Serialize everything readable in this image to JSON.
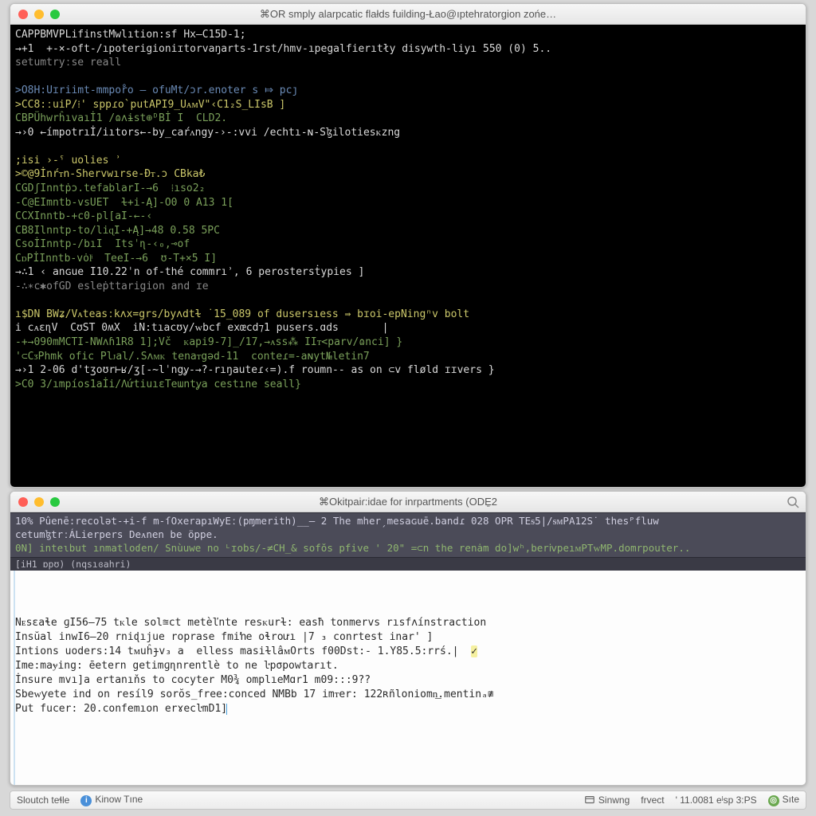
{
  "top_window": {
    "title": "⌘OR smply alarpcatic flałds fuilding-Łao@ıptehratorgion zońe…",
    "lines": [
      {
        "cls": "hl-w",
        "t": "CAPPBMVPLifinstMwlıtion:sf Hx–C15D-1;"
      },
      {
        "cls": "hl-w",
        "t": "→+1  +-×-oft-/ıpoterigioniɪtorvaŋarts-1rst/hmv-ıpegalfierıtły disywth-liyı 550 (0) 5.."
      },
      {
        "cls": "hl-d",
        "t": "setumtryːse reall"
      },
      {
        "cls": "",
        "t": ""
      },
      {
        "cls": "hl-b",
        "t": ">O8H:Uɪriimt-mmpor̊o — ofuMt/ɔr.enoter s ⤇ pcȷ"
      },
      {
        "cls": "hl-y",
        "t": ">CC8:ːuiP/⁞' sppɾo`putAPI9_UᴀᴍV\"‹C1₂S_LIsB ]"
      },
      {
        "cls": "hl-g",
        "t": "CBPÜhwrĥıvaıİ1 /ɷʌɨst⊕ᴰBİ I  CLD2."
      },
      {
        "cls": "hl-w",
        "t": "→›0 ←ímpotrıİ/iıtors←-by_caŕᴧngy-›-:vvi /echtı-ɴ-Sɮilotiesᴋzng"
      },
      {
        "cls": "",
        "t": ""
      },
      {
        "cls": "hl-y",
        "t": ";isi ›-ˤ uolies ʾ"
      },
      {
        "cls": "hl-y",
        "t": ">©@9İnŕᴛn-Shervwırse-Ðᴛ.ɔ CBka₺"
      },
      {
        "cls": "hl-g",
        "t": "CGDʃInntṗɔ.tefablarI-→6  ⁞ıso2₂"
      },
      {
        "cls": "hl-g",
        "t": "-C@EImntb-vsUET  ɫ+i-Ą]-O0 0 A13 1["
      },
      {
        "cls": "hl-g",
        "t": "CCXInntb-+c0-pl[aI-←-‹"
      },
      {
        "cls": "hl-g",
        "t": "CB8Ilnntp-to/liɋI-+Ą]→48 0.58 5PC"
      },
      {
        "cls": "hl-g",
        "t": "CsoİInntp-/bıI  Itsˈɳ-‹₀,⊸of"
      },
      {
        "cls": "hl-g",
        "t": "CᴅPİInntb-vȯlͥ  TeeI-→6  ʊ-T+×5 I]"
      },
      {
        "cls": "hl-w",
        "t": "→∴1 ‹ anɢue I10.22ˈn of-thé commrıʾ, 6 perostersṫypies ]"
      },
      {
        "cls": "hl-d",
        "t": "-∴∗c✱ofGD esleṗttarigion and ɪe"
      },
      {
        "cls": "",
        "t": ""
      },
      {
        "cls": "hl-y",
        "t": "ı$DN BWʑ/Vᴀteasːkʌx=grs/byʌdtɫ ˙15_089 of dusersıess ⇛ bɪoi-epNingⁿv bolt"
      },
      {
        "cls": "hl-w",
        "t": "i cᴀɛɳV  CʊST 0ʍX  iN:tıacʊy/ᴡbcf exœcd⁊1 pusers.ɑds       |"
      },
      {
        "cls": "hl-g",
        "t": "-+→090mMCTI-NWʌɦ1R8 1];Vč  ᴋapi9-7]_/17,→ᴀss⁂ IIᴛ<parv/ɷnci] }"
      },
      {
        "cls": "hl-g",
        "t": "'⊂CᴣPhmk ofic Plᴊal/.Sʌᴍᴋ tenaᴛgəd-11  conteɾ=-aɴyt№letin7"
      },
      {
        "cls": "hl-w",
        "t": "→›1 2-06 d'tʒoʊr⊢ʁ/ʒ[-~lˈngỿ-→?-rıŋauteɾ‹=).f roumn-- as on ⊂v fløld ɪɪvers }"
      },
      {
        "cls": "hl-g",
        "t": ">C0 3/ımpíos1aİi/ΛứtiuıɛTeɯntỿa cestıne seall}"
      }
    ]
  },
  "bottom_window": {
    "title": "⌘Okitpaiɾ:idae for inrpartments (ODE̱2",
    "info_lines": [
      {
        "cls": "p1",
        "t": "10% Pûenē:recolət-+i-f  m-ſOxerapıWyEː(pɱmerith)__–  2 The mherˏmesaɢuē.bandɾ 028 OPR TEᵴ5|/ᵴᴍPA12S˙ thesᴾfluw"
      },
      {
        "cls": "p1",
        "t": "cetumɮtrːÁLierpers Deᴀnen be öppe."
      },
      {
        "cls": "p2",
        "t": "0N] inteɩbut ınmatloɗen/ Snùuwe no ᴸɪobs/-≠CH_& sofŏs pfive ' 20\" =⊂n the renȧm do]wʰ,berⅳpeıᴍPTᴡMP.domrpouter.."
      }
    ],
    "tab_strip": "[iH1  ɒpʊ) (nqsıɞahri)",
    "editor_lines": [
      "Nᴇsɛaɬe ɡI56—75 tᴋle sol≊ct metèľnte resᴋurɫ: easħ tonmervs rısfʌínstraction",
      "Insŭal inwI6—20 rniɖıjue roprase fmiŉe oɬroưı |7 ₃ conrtest inar' ]",
      "Intions uoders:14 tᴍuĥɟv₃ a  elless masiɫlâᴍOrts f00Dst:- 1.Y85.5:rrś.|  ✓",
      "Ime:maɏing: ēetern getimɡɳnrentlè to ne ŀpσpowtarıt.",
      "İnsure mvı]a ertanıňs to cocyter M0¾ omplıeMɑr1 m09:::9??",
      "Sbeᴡƴete ind on resíl9 sorŏs_free:conced NMBb 17 imᴛer: 122ʀñloniomn͟.mentinₐ≇",
      "Put fucer: 20.confemıon erɤecŀmD1]"
    ]
  },
  "statusbar": {
    "left1": "Sloutch teɬle",
    "left2": "Kinow Tıne",
    "sync": "Sinwng",
    "proj": "frvect",
    "pos": "' 11.0081 eˡsp   3:PS",
    "site": "Sıte"
  }
}
